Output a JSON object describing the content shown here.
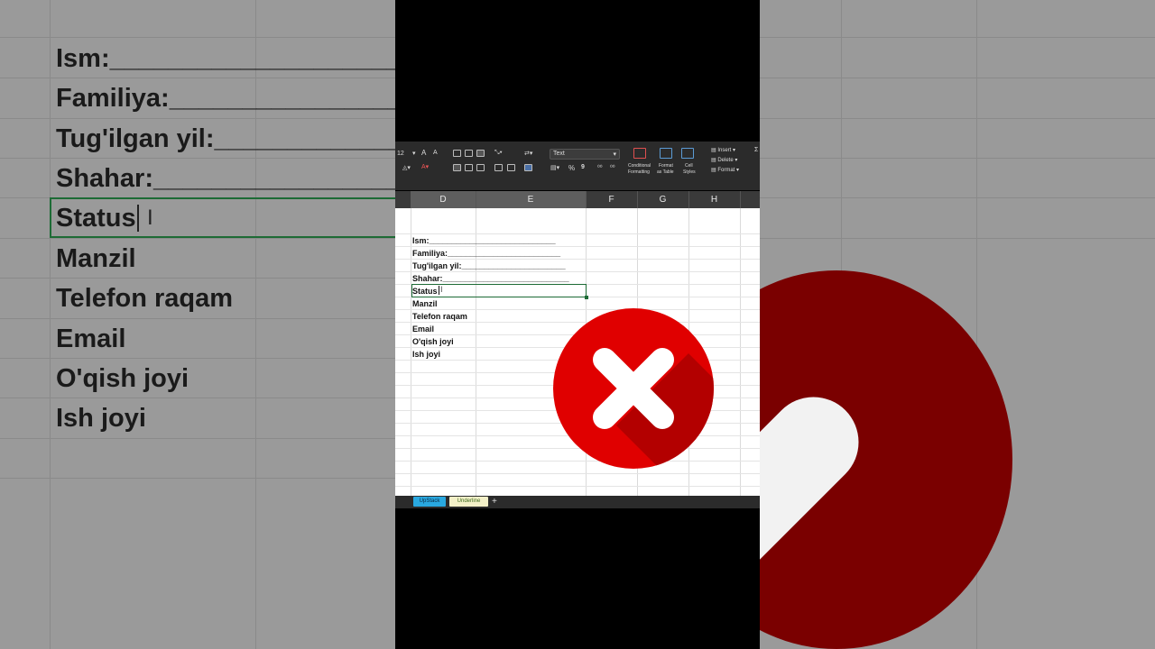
{
  "background_left": {
    "rows": [
      "Ism:_______________________",
      "Familiya:__________________",
      "Tug'ilgan yil:_____________",
      "Shahar:____________________",
      "Status",
      "Manzil",
      "Telefon raqam",
      "Email",
      "O'qish joyi",
      "Ish joyi"
    ]
  },
  "ribbon": {
    "font_size": "12",
    "number_format": "Text",
    "conditional_formatting": [
      "Conditional",
      "Formatting"
    ],
    "format_as_table": [
      "Format",
      "as Table"
    ],
    "cell_styles": [
      "Cell",
      "Styles"
    ],
    "insert": "Insert",
    "delete": "Delete",
    "format": "Format",
    "percent_symbol": "%",
    "comma_symbol": "9"
  },
  "columns": [
    "D",
    "E",
    "F",
    "G",
    "H"
  ],
  "sheet": {
    "rows": [
      "Ism:____________________________",
      "Familiya:_________________________",
      "Tug'ilgan yil:_______________________",
      "Shahar:____________________________",
      "Status",
      "Manzil",
      "Telefon raqam",
      "Email",
      "O'qish joyi",
      "Ish joyi"
    ]
  },
  "tabs": [
    {
      "label": "UpStack",
      "bg": "#29a8e0",
      "color": "#0b2740"
    },
    {
      "label": "Underline",
      "bg": "#f3f0c8",
      "color": "#3e6b1d"
    }
  ],
  "tab_add": "+",
  "overlay": {
    "icon": "x-mark-icon",
    "color": "#e00000"
  }
}
